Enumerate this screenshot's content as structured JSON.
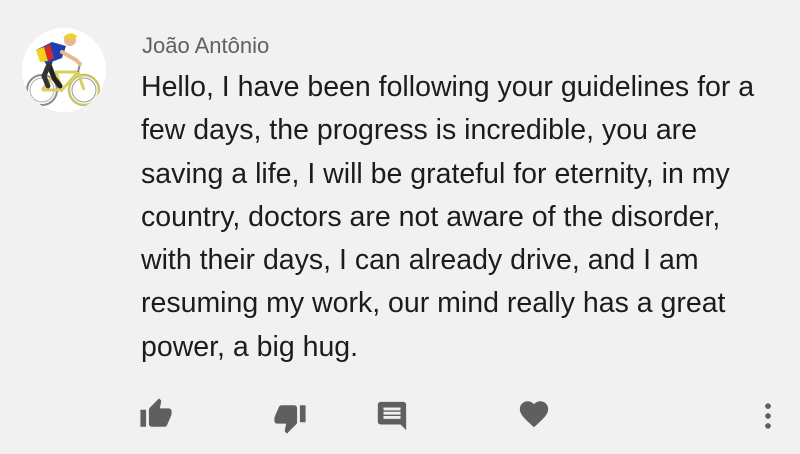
{
  "comment": {
    "author": "João Antônio",
    "text": "Hello, I have been following your guidelines for a few days, the progress is incredible, you are saving a life, I will be grateful for eternity, in my country, doctors are not aware of the disorder, with their days, I can already drive, and I am resuming my work, our mind really has a great power, a big hug.",
    "avatar_icon": "cyclist-avatar"
  },
  "actions": {
    "like_icon": "thumbs-up-icon",
    "dislike_icon": "thumbs-down-icon",
    "reply_icon": "comment-icon",
    "heart_icon": "heart-icon",
    "more_icon": "more-vertical-icon"
  },
  "colors": {
    "background": "#f1f1f1",
    "text": "#1c1c1c",
    "author": "#606060",
    "icon": "#5f5f5f"
  }
}
